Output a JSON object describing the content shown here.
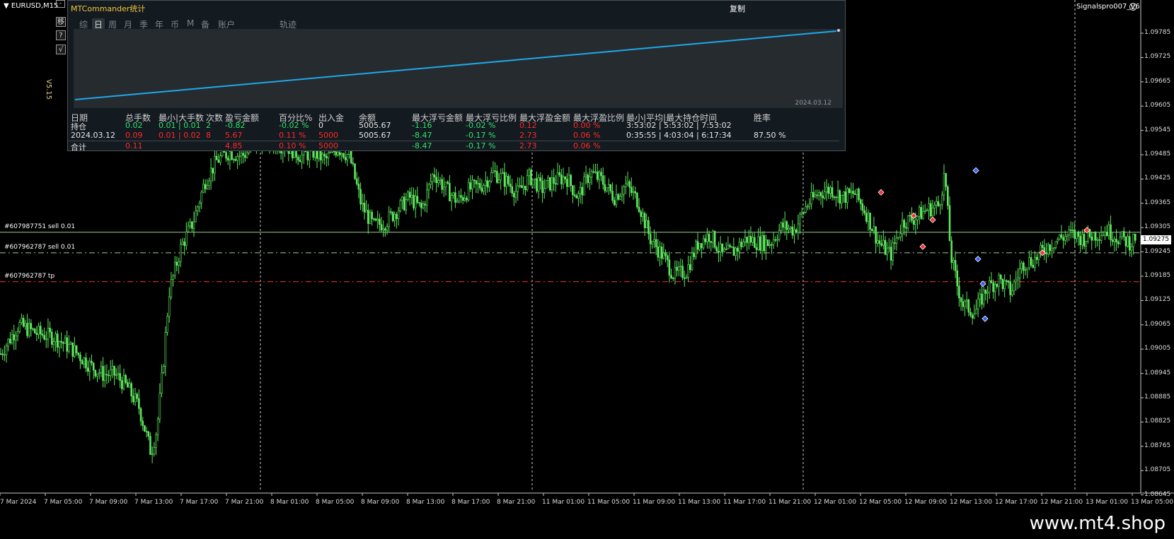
{
  "window": {
    "symbol": "EURUSD,M15",
    "min_button": "-",
    "side_buttons": [
      "移",
      "?",
      "√"
    ],
    "version": "V5.15",
    "signal_name": "Signalspro007_V6",
    "smiley": "☺"
  },
  "panel": {
    "title": "MTCommander统计",
    "copy_label": "复制",
    "tabs": [
      "综",
      "日",
      "周",
      "月",
      "季",
      "年",
      "币",
      "M",
      "备",
      "账户",
      "轨迹"
    ],
    "active_tab": "日",
    "mini_chart_date": "2024.03.12",
    "headers": [
      "日期",
      "总手数",
      "最小|大手数",
      "次数",
      "盈亏金额",
      "百分比%",
      "出入金",
      "余额",
      "最大浮亏金额",
      "最大浮亏比例",
      "最大浮盈金额",
      "最大浮盈比例",
      "最小|平均|最大持仓时间",
      "胜率"
    ],
    "rows": [
      [
        "持仓",
        "0.02",
        "0.01 | 0.01",
        "2",
        "-0.82",
        "-0.02 %",
        "0",
        "5005.67",
        "-1.16",
        "-0.02 %",
        "0.12",
        "0.00 %",
        "3:53:02 | 5:53:02 | 7:53:02",
        ""
      ],
      [
        "2024.03.12",
        "0.09",
        "0.01 | 0.02",
        "8",
        "5.67",
        "0.11 %",
        "5000",
        "5005.67",
        "-8.47",
        "-0.17 %",
        "2.73",
        "0.06 %",
        "0:35:55 | 4:03:04 | 6:17:34",
        "87.50 %"
      ],
      [
        "合计",
        "0.11",
        "",
        "",
        "4.85",
        "0.10 %",
        "5000",
        "",
        "-8.47",
        "-0.17 %",
        "2.73",
        "0.06 %",
        "",
        ""
      ]
    ]
  },
  "orders": [
    {
      "label": "#607987751 sell 0.01",
      "price": 1.09275
    },
    {
      "label": "#607962787 sell 0.01",
      "price": 1.09225
    },
    {
      "label": "#607962787 tp",
      "price": 1.09155
    }
  ],
  "price_axis": [
    "1.09785",
    "1.09725",
    "1.09665",
    "1.09605",
    "1.09545",
    "1.09485",
    "1.09425",
    "1.09365",
    "1.09305",
    "1.09245",
    "1.09185",
    "1.09125",
    "1.09065",
    "1.09005",
    "1.08945",
    "1.08885",
    "1.08825",
    "1.08765",
    "1.08705",
    "1.08645"
  ],
  "current_price": "1.09275",
  "time_axis": [
    "7 Mar 2024",
    "7 Mar 05:00",
    "7 Mar 09:00",
    "7 Mar 13:00",
    "7 Mar 17:00",
    "7 Mar 21:00",
    "8 Mar 01:00",
    "8 Mar 05:00",
    "8 Mar 09:00",
    "8 Mar 13:00",
    "8 Mar 17:00",
    "8 Mar 21:00",
    "11 Mar 01:00",
    "11 Mar 05:00",
    "11 Mar 09:00",
    "11 Mar 13:00",
    "11 Mar 17:00",
    "11 Mar 21:00",
    "12 Mar 01:00",
    "12 Mar 05:00",
    "12 Mar 09:00",
    "12 Mar 13:00",
    "12 Mar 17:00",
    "12 Mar 21:00",
    "13 Mar 01:00",
    "13 Mar 05:00"
  ],
  "brand": "www.mt4.shop",
  "colors": {
    "candle": "#5ee85e",
    "order_line": "#9acd8a",
    "tp_line": "#ff3030",
    "equity_line": "#1fa8e8"
  },
  "chart_data": {
    "type": "line",
    "price_points": [
      [
        0,
        1.0898
      ],
      [
        3,
        1.0905
      ],
      [
        6,
        1.0903
      ],
      [
        9,
        1.0902
      ],
      [
        12,
        1.0899
      ],
      [
        15,
        1.0895
      ],
      [
        17,
        1.0893
      ],
      [
        19,
        1.0893
      ],
      [
        21,
        1.089
      ],
      [
        23,
        1.0885
      ],
      [
        25,
        1.0874
      ],
      [
        26,
        1.088
      ],
      [
        27,
        1.0895
      ],
      [
        28,
        1.0913
      ],
      [
        30,
        1.0924
      ],
      [
        32,
        1.093
      ],
      [
        34,
        1.094
      ],
      [
        36,
        1.0945
      ],
      [
        38,
        1.0947
      ],
      [
        40,
        1.0946
      ],
      [
        42,
        1.0948
      ],
      [
        44,
        1.095
      ],
      [
        46,
        1.0949
      ],
      [
        48,
        1.0948
      ],
      [
        50,
        1.0946
      ],
      [
        52,
        1.0947
      ],
      [
        54,
        1.0945
      ],
      [
        56,
        1.0948
      ],
      [
        58,
        1.0946
      ],
      [
        60,
        1.0934
      ],
      [
        62,
        1.0929
      ],
      [
        64,
        1.093
      ],
      [
        66,
        1.0933
      ],
      [
        68,
        1.0936
      ],
      [
        70,
        1.0933
      ],
      [
        72,
        1.0942
      ],
      [
        74,
        1.0938
      ],
      [
        76,
        1.0935
      ],
      [
        78,
        1.0938
      ],
      [
        80,
        1.0939
      ],
      [
        82,
        1.0942
      ],
      [
        84,
        1.094
      ],
      [
        86,
        1.0937
      ],
      [
        88,
        1.0941
      ],
      [
        90,
        1.0938
      ],
      [
        92,
        1.094
      ],
      [
        94,
        1.0941
      ],
      [
        96,
        1.0936
      ],
      [
        98,
        1.0942
      ],
      [
        100,
        1.094
      ],
      [
        102,
        1.0936
      ],
      [
        104,
        1.0939
      ],
      [
        106,
        1.0935
      ],
      [
        108,
        1.0926
      ],
      [
        110,
        1.0922
      ],
      [
        112,
        1.0917
      ],
      [
        114,
        1.0918
      ],
      [
        116,
        1.0925
      ],
      [
        118,
        1.0927
      ],
      [
        120,
        1.0922
      ],
      [
        122,
        1.0923
      ],
      [
        124,
        1.0926
      ],
      [
        126,
        1.0925
      ],
      [
        128,
        1.0925
      ],
      [
        130,
        1.0929
      ],
      [
        132,
        1.0928
      ],
      [
        134,
        1.0934
      ],
      [
        136,
        1.0937
      ],
      [
        138,
        1.0938
      ],
      [
        140,
        1.0936
      ],
      [
        142,
        1.0937
      ],
      [
        144,
        1.0932
      ],
      [
        146,
        1.0925
      ],
      [
        148,
        1.0922
      ],
      [
        150,
        1.093
      ],
      [
        152,
        1.0931
      ],
      [
        154,
        1.0933
      ],
      [
        156,
        1.0934
      ],
      [
        157,
        1.0942
      ],
      [
        158,
        1.0922
      ],
      [
        159,
        1.0915
      ],
      [
        160,
        1.091
      ],
      [
        162,
        1.0908
      ],
      [
        164,
        1.0914
      ],
      [
        166,
        1.0916
      ],
      [
        168,
        1.0913
      ],
      [
        170,
        1.092
      ],
      [
        172,
        1.0921
      ],
      [
        174,
        1.0924
      ],
      [
        176,
        1.0926
      ],
      [
        178,
        1.0927
      ],
      [
        180,
        1.0926
      ],
      [
        182,
        1.0927
      ],
      [
        184,
        1.0928
      ],
      [
        186,
        1.0926
      ],
      [
        188,
        1.0925
      ],
      [
        189,
        1.0927
      ]
    ],
    "equity": [
      5000.0,
      5005.67
    ],
    "ylim": [
      1.08645,
      1.09815
    ]
  }
}
